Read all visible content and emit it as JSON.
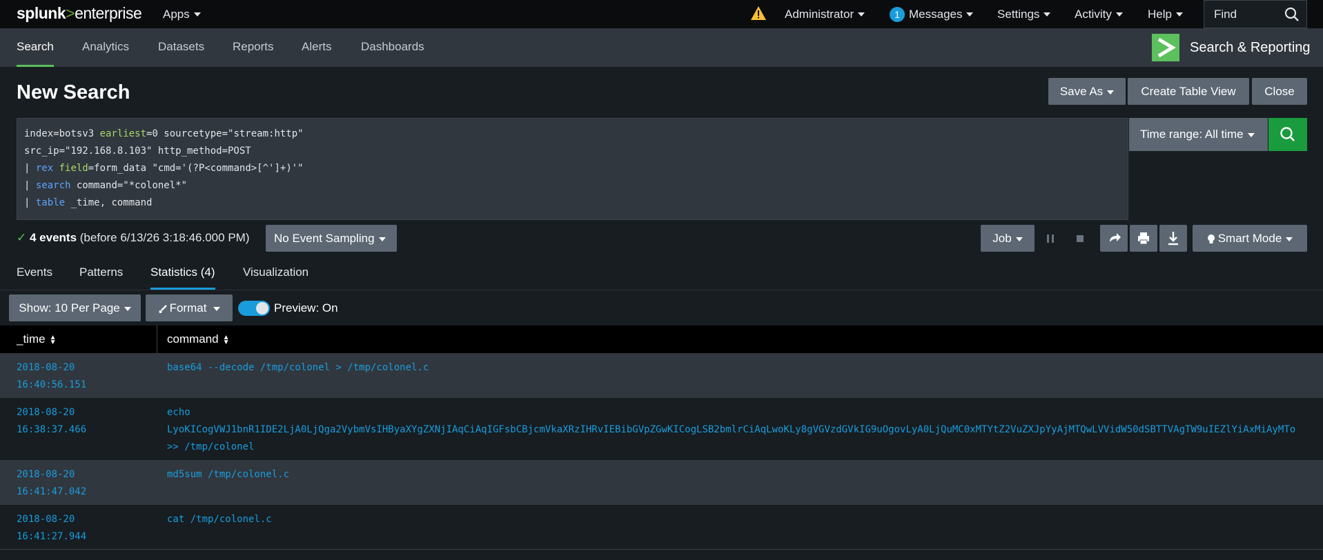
{
  "brand": {
    "splunk": "splunk",
    "sep": ">",
    "product": "enterprise"
  },
  "topnav": {
    "apps": "Apps",
    "administrator": "Administrator",
    "messages_count": "1",
    "messages": "Messages",
    "settings": "Settings",
    "activity": "Activity",
    "help": "Help",
    "find": "Find"
  },
  "appbar": {
    "tabs": [
      "Search",
      "Analytics",
      "Datasets",
      "Reports",
      "Alerts",
      "Dashboards"
    ],
    "app_title": "Search & Reporting"
  },
  "page": {
    "title": "New Search",
    "save_as": "Save As",
    "create_table_view": "Create Table View",
    "close": "Close"
  },
  "search": {
    "line1_a": "index=botsv3 ",
    "line1_kw": "earliest",
    "line1_b": "=0 sourcetype=\"stream:http\"",
    "line2": "src_ip=\"192.168.8.103\" http_method=POST",
    "line3_pipe": "| ",
    "line3_cmd": "rex",
    "line3_sp": " ",
    "line3_kw": "field",
    "line3_b": "=form_data \"cmd='(?P<command>[^']+)'\"",
    "line4_pipe": "| ",
    "line4_cmd": "search",
    "line4_b": " command=\"*colonel*\"",
    "line5_pipe": "| ",
    "line5_cmd": "table",
    "line5_b": " _time, command",
    "time_range": "Time range: All time"
  },
  "status": {
    "check": "✓",
    "events": "4 events",
    "before": " (before 6/13/26 3:18:46.000 PM)",
    "sampling": "No Event Sampling",
    "job": "Job",
    "smart_mode": "Smart Mode"
  },
  "result_tabs": [
    "Events",
    "Patterns",
    "Statistics (4)",
    "Visualization"
  ],
  "controls": {
    "show": "Show: 10 Per Page",
    "format": "Format",
    "preview": "Preview: On"
  },
  "table": {
    "columns": [
      "_time",
      "command"
    ],
    "rows": [
      {
        "date": "2018-08-20",
        "time": "16:40:56.151",
        "cmd": [
          "base64 --decode /tmp/colonel > /tmp/colonel.c"
        ]
      },
      {
        "date": "2018-08-20",
        "time": "16:38:37.466",
        "cmd": [
          "echo",
          "LyoKICogVWJ1bnR1IDE2LjA0LjQga2VybmVsIHByaXYgZXNjIAqCiAqIGFsbCBjcmVkaXRzIHRvIEBibGVpZGwKICogLSB2bmlrCiAqLwoKLy8gVGVzdGVkIG9uOgovLyA0LjQuMC0xMTYtZ2VuZXJpYyAjMTQwLVVidW50dSBTTVAgTW9uIEZlYiAxMiAyMTo",
          ">> /tmp/colonel"
        ]
      },
      {
        "date": "2018-08-20",
        "time": "16:41:47.042",
        "cmd": [
          "md5sum /tmp/colonel.c"
        ]
      },
      {
        "date": "2018-08-20",
        "time": "16:41:27.944",
        "cmd": [
          "cat /tmp/colonel.c"
        ]
      }
    ]
  }
}
